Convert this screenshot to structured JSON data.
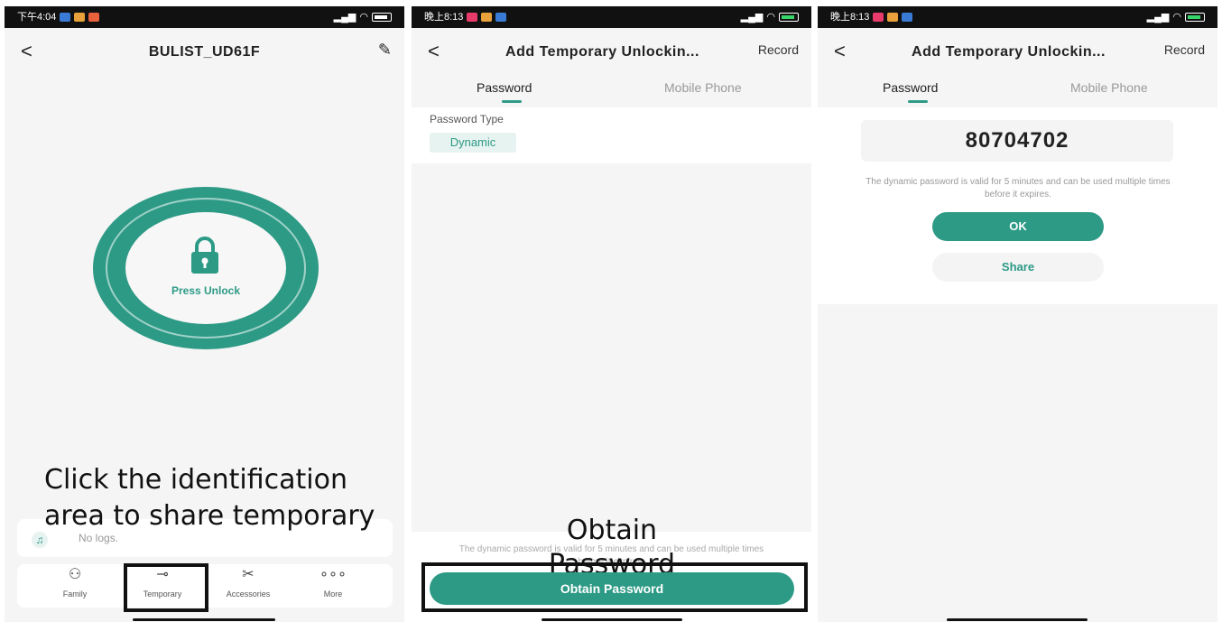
{
  "colors": {
    "accent": "#2d9a86",
    "accent_light": "#e7f3f0",
    "background": "#f5f5f5"
  },
  "screen1": {
    "status_time": "下午4:04",
    "title": "BULIST_UD61F",
    "press_unlock": "Press Unlock",
    "annotation": "Click the identification area to share temporary",
    "no_logs": "No logs.",
    "tabs": [
      {
        "label": "Family",
        "icon": "user-icon"
      },
      {
        "label": "Temporary",
        "icon": "key-icon"
      },
      {
        "label": "Accessories",
        "icon": "tools-icon"
      },
      {
        "label": "More",
        "icon": "more-icon"
      }
    ]
  },
  "screen2": {
    "status_time": "晚上8:13",
    "title": "Add Temporary Unlockin...",
    "record": "Record",
    "tab_password": "Password",
    "tab_mobile": "Mobile Phone",
    "password_type_label": "Password Type",
    "password_type_value": "Dynamic",
    "note": "The dynamic password is valid for 5 minutes and can be used multiple times before it expires.",
    "annotation": "Obtain Password",
    "obtain_button": "Obtain Password"
  },
  "screen3": {
    "status_time": "晚上8:13",
    "title": "Add Temporary Unlockin...",
    "record": "Record",
    "tab_password": "Password",
    "tab_mobile": "Mobile Phone",
    "password": "80704702",
    "note": "The dynamic password is valid for 5 minutes and can be used multiple times before it expires.",
    "ok_button": "OK",
    "share_button": "Share"
  }
}
